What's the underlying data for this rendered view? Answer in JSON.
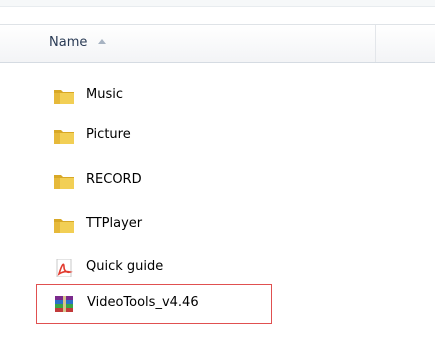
{
  "header": {
    "name_label": "Name"
  },
  "files": [
    {
      "label": "Music",
      "icon": "folder-icon"
    },
    {
      "label": "Picture",
      "icon": "folder-icon"
    },
    {
      "label": "RECORD",
      "icon": "folder-icon"
    },
    {
      "label": "TTPlayer",
      "icon": "folder-icon"
    },
    {
      "label": "Quick guide",
      "icon": "pdf-icon"
    },
    {
      "label": "VideoTools_v4.46",
      "icon": "archive-icon"
    }
  ],
  "colors": {
    "folder": "#e8c23a",
    "pdf": "#e23b2f",
    "highlight_border": "#e05050"
  }
}
